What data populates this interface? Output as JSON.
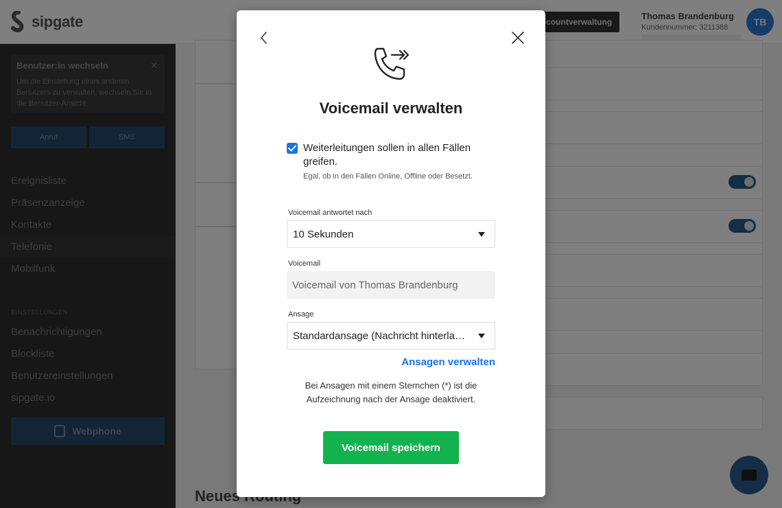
{
  "app": {
    "logo_text": "sipgate",
    "account_button": "Accountverwaltung",
    "user_name": "Thomas Brandenburg",
    "customer_number": "Kundennummer: 3211388",
    "avatar_initials": "TB"
  },
  "sidebar": {
    "switch_user": {
      "title": "Benutzer:in wechseln",
      "text": "Um die Einstellung eines anderen Benutzers zu verwalten, wechseln Sie in die Benutzer-Ansicht."
    },
    "call_button": "Anruf",
    "sms_button": "SMS",
    "items": [
      {
        "label": "Ereignisliste"
      },
      {
        "label": "Präsenzanzeige"
      },
      {
        "label": "Kontakte"
      },
      {
        "label": "Telefonie"
      },
      {
        "label": "Mobilfunk"
      }
    ],
    "settings_label": "EINSTELLUNGEN",
    "settings_items": [
      {
        "label": "Benachrichtigungen"
      },
      {
        "label": "Blockliste"
      },
      {
        "label": "Benutzereinstellungen"
      },
      {
        "label": "sipgate.io"
      }
    ],
    "webphone_button": "Webphone"
  },
  "content": {
    "section_heading": "Neues Routing"
  },
  "modal": {
    "title": "Voicemail verwalten",
    "forwarding_checkbox": {
      "checked": true,
      "label": "Weiterleitungen sollen in allen Fällen greifen.",
      "sublabel": "Egal, ob in den Fällen Online, Offline oder Besetzt."
    },
    "voicemail_delay": {
      "label": "Voicemail antwortet nach",
      "value": "10 Sekunden"
    },
    "voicemail_name": {
      "label": "Voicemail",
      "placeholder": "Voicemail von Thomas Brandenburg"
    },
    "announcement": {
      "label": "Ansage",
      "value": "Standardansage (Nachricht hinterlassen)"
    },
    "manage_link": "Ansagen verwalten",
    "note": "Bei Ansagen mit einem Sternchen (*) ist die Aufzeichnung nach der Ansage deaktiviert.",
    "save_button": "Voicemail speichern"
  },
  "colors": {
    "primary": "#1a73e8",
    "save_green": "#12b34f",
    "sidebar_bg": "#2e2e2e"
  }
}
